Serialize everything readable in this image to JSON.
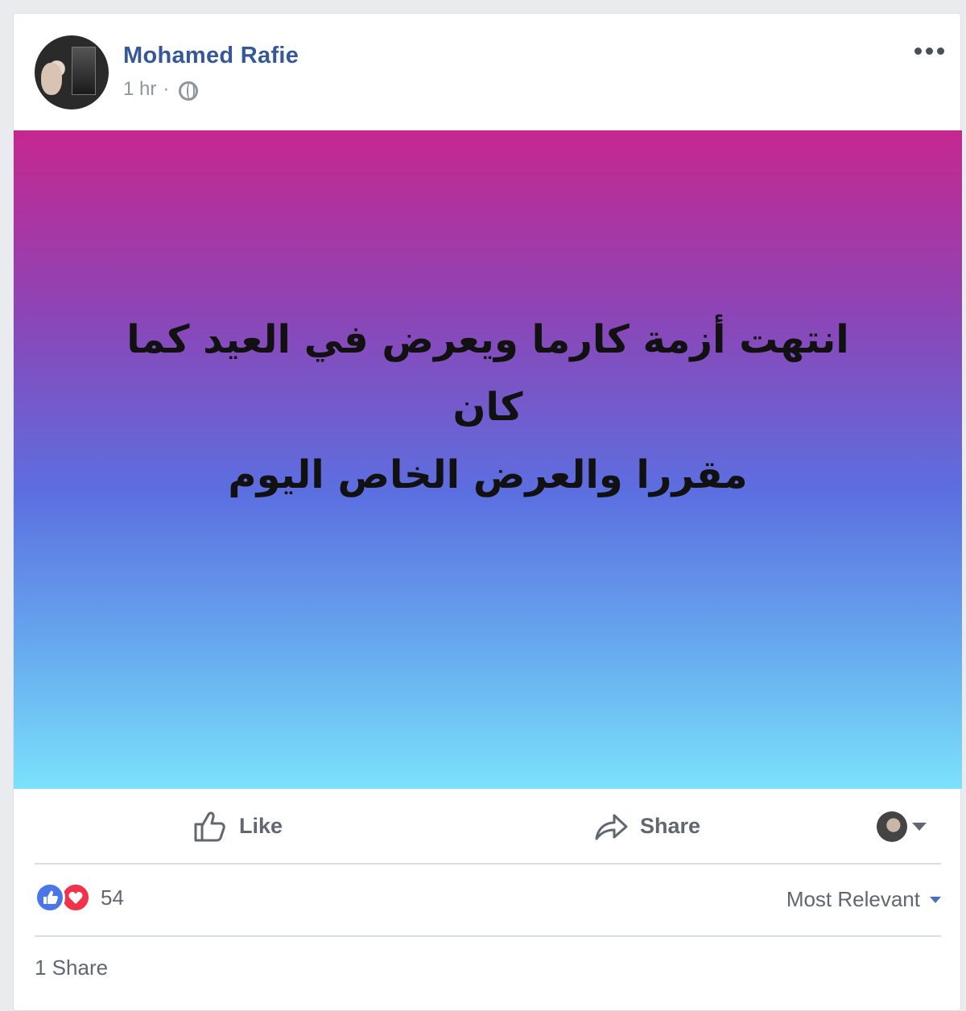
{
  "post": {
    "author": "Mohamed Rafie",
    "time": "1 hr",
    "separator": "·",
    "audience_icon": "globe-icon",
    "text_line1": "انتهت أزمة كارما ويعرض في العيد كما كان",
    "text_line2": "مقررا والعرض الخاص اليوم",
    "gradient_colors": [
      "#c6278f",
      "#8c45b6",
      "#5c6fe0",
      "#66a8ee",
      "#7ae2fb"
    ]
  },
  "actions": {
    "like_label": "Like",
    "share_label": "Share"
  },
  "reactions": {
    "count": "54",
    "sort_label": "Most Relevant",
    "like_color": "#4a76e8",
    "love_color": "#f0334b"
  },
  "shares": {
    "label": "1 Share"
  },
  "colors": {
    "author": "#365899",
    "meta": "#90949c",
    "action_text": "#606770"
  }
}
